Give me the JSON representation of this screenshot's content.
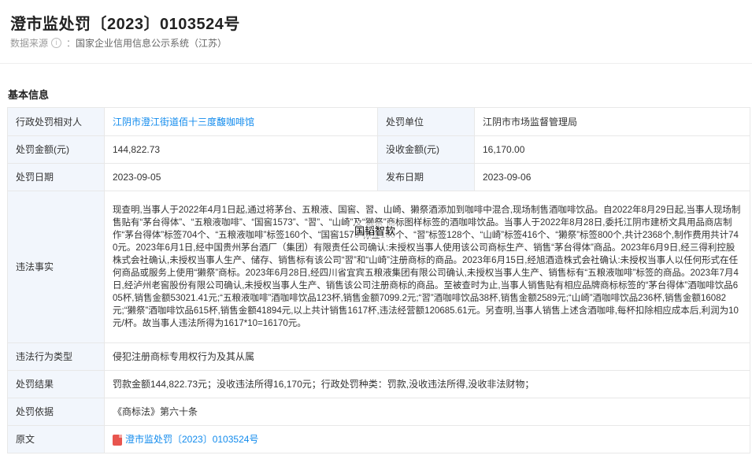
{
  "header": {
    "title": "澄市监处罚〔2023〕0103524号",
    "source_label": "数据来源",
    "source_value": "国家企业信用信息公示系统（江苏）",
    "info_icon": "info-icon"
  },
  "section_title": "基本信息",
  "rows": {
    "r1": {
      "l1": "行政处罚相对人",
      "v1": "江阴市澄江街道佰十三度馥咖啡馆",
      "l2": "处罚单位",
      "v2": "江阴市市场监督管理局"
    },
    "r2": {
      "l1": "处罚金额(元)",
      "v1": "144,822.73",
      "l2": "没收金额(元)",
      "v2": "16,170.00"
    },
    "r3": {
      "l1": "处罚日期",
      "v1": "2023-09-05",
      "l2": "发布日期",
      "v2": "2023-09-06"
    },
    "facts": {
      "label": "违法事实",
      "text": "现查明,当事人于2022年4月1日起,通过将茅台、五粮液、国窖、習、山崎、獭祭酒添加到咖啡中混合,现场制售酒咖啡饮品。自2022年8月29日起,当事人现场制售贴有“茅台得体”、“五粮液咖啡”、“国窖1573”、“習”、“山崎”及“獭祭”商标图样标签的酒咖啡饮品。当事人于2022年8月28日,委托江阴市建桥文具用品商店制作“茅台得体”标签704个、“五粮液咖啡”标签160个、“国窖1573”标签160个、“習”标签128个、“山崎”标签416个、“獭祭”标签800个,共计2368个,制作费用共计740元。2023年6月1日,经中国贵州茅台酒厂（集团）有限责任公司确认:未授权当事人使用该公司商标生产、销售“茅台得体”商品。2023年6月9日,经三得利控股株式会社确认,未授权当事人生产、储存、销售标有该公司“習”和“山崎”注册商标的商品。2023年6月15日,经旭酒造株式会社确认:未授权当事人以任何形式在任何商品或服务上使用“獭祭”商标。2023年6月28日,经四川省宜宾五粮液集团有限公司确认,未授权当事人生产、销售标有“五粮液咖啡”标签的商品。2023年7月4日,经泸州老窖股份有限公司确认,未授权当事人生产、销售该公司注册商标的商品。至被查时为止,当事人销售贴有相应品牌商标标签的“茅台得体”酒咖啡饮品605杯,销售金额53021.41元;“五粮液咖啡”酒咖啡饮品123杯,销售金额7099.2元;“習”酒咖啡饮品38杯,销售金额2589元;“山崎”酒咖啡饮品236杯,销售金额16082元;“獭祭”酒咖啡饮品615杯,销售金额41894元,以上共计销售1617杯,违法经营额120685.61元。另查明,当事人销售上述含酒咖啡,每杯扣除相应成本后,利润为10元/杯。故当事人违法所得为1617*10=16170元。"
    },
    "type": {
      "label": "违法行为类型",
      "value": "侵犯注册商标专用权行为及其从属"
    },
    "result": {
      "label": "处罚结果",
      "value": "罚款金额144,822.73元；没收违法所得16,170元；行政处罚种类：罚款,没收违法所得,没收非法财物；"
    },
    "basis": {
      "label": "处罚依据",
      "value": "《商标法》第六十条"
    },
    "original": {
      "label": "原文",
      "value": "澄市监处罚〔2023〕0103524号",
      "icon": "pdf-icon"
    }
  },
  "watermark": "国韬智软"
}
